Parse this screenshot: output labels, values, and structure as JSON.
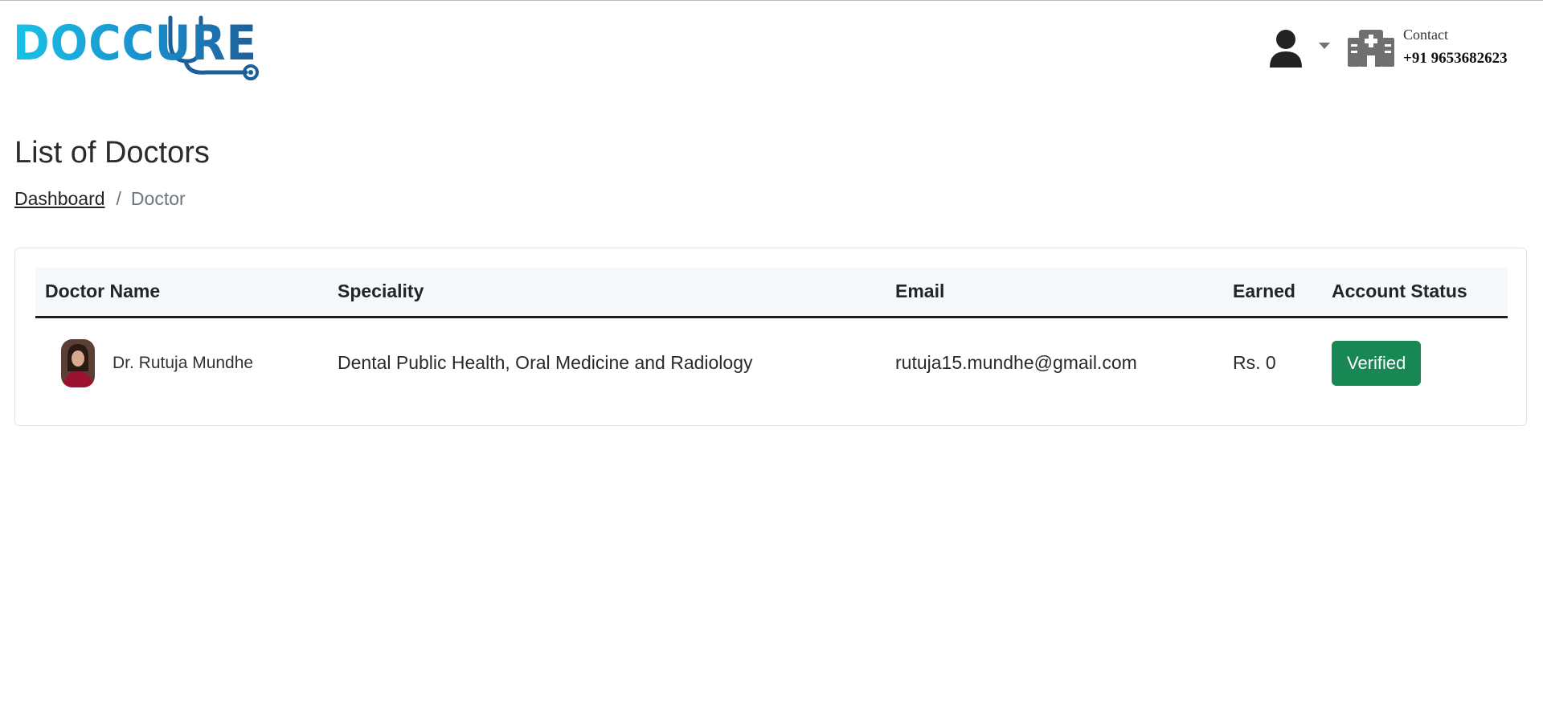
{
  "header": {
    "logo_text": "DOCCURE",
    "contact_label": "Contact",
    "contact_phone": "+91 9653682623"
  },
  "page": {
    "title": "List of Doctors",
    "breadcrumb": {
      "home": "Dashboard",
      "separator": "/",
      "current": "Doctor"
    }
  },
  "table": {
    "columns": [
      "Doctor Name",
      "Speciality",
      "Email",
      "Earned",
      "Account Status"
    ],
    "rows": [
      {
        "name": "Dr. Rutuja Mundhe",
        "speciality": "Dental Public Health, Oral Medicine and Radiology",
        "email": "rutuja15.mundhe@gmail.com",
        "earned": "Rs. 0",
        "status": "Verified"
      }
    ]
  },
  "colors": {
    "logo_cyan": "#19c3e6",
    "logo_blue": "#1d5f99",
    "verified": "#198754"
  },
  "icons": [
    "user-icon",
    "chevron-down-icon",
    "hospital-icon",
    "stethoscope-icon"
  ]
}
